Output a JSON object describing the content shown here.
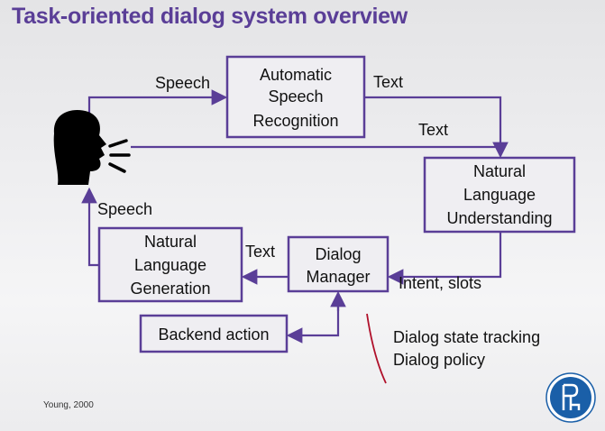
{
  "title": "Task-oriented dialog system overview",
  "boxes": {
    "asr": [
      "Automatic",
      "Speech",
      "Recognition"
    ],
    "nlu": [
      "Natural",
      "Language",
      "Understanding"
    ],
    "dm": [
      "Dialog",
      "Manager"
    ],
    "nlg": [
      "Natural",
      "Language",
      "Generation"
    ],
    "backend": "Backend action"
  },
  "edge_labels": {
    "speech_in": "Speech",
    "asr_text": "Text",
    "text_nlu": "Text",
    "speech_out": "Speech",
    "dm_text": "Text",
    "intent_slots": "Intent, slots"
  },
  "dm_notes": [
    "Dialog state tracking",
    "Dialog policy"
  ],
  "citation": "Young, 2000",
  "colors": {
    "accent": "#5a3e97",
    "note_line": "#b0102a",
    "logo": "#1a5fa8"
  },
  "icons": {
    "speaker": "speaking-head-icon",
    "logo": "university-logo"
  }
}
